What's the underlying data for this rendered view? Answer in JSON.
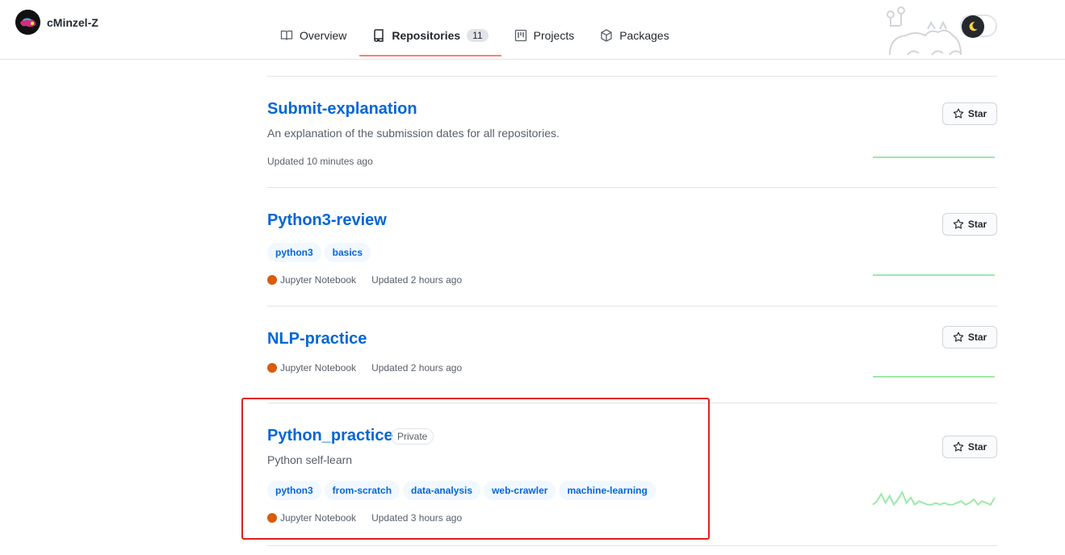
{
  "user": {
    "name": "cMinzel-Z"
  },
  "tabs": [
    {
      "label": "Overview",
      "icon": "book-icon"
    },
    {
      "label": "Repositories",
      "icon": "repo-icon",
      "count": "11"
    },
    {
      "label": "Projects",
      "icon": "project-icon"
    },
    {
      "label": "Packages",
      "icon": "package-icon"
    }
  ],
  "theme_toggle": {
    "icon": "moon-icon",
    "accent": "#ffd33d"
  },
  "colors": {
    "link": "#0366d6",
    "jupyter": "#DA5B0B",
    "spark": "#9be9a8",
    "highlight": "#e0201c",
    "tab_underline": "#f9826c"
  },
  "repos": [
    {
      "name": "Submit-explanation",
      "description": "An explanation of the submission dates for all repositories.",
      "topics": [],
      "language": "",
      "updated": "Updated 10 minutes ago",
      "star_label": "Star",
      "activity": [
        0,
        0,
        0,
        0,
        0,
        0,
        0,
        0,
        0,
        0,
        0,
        0,
        0,
        0,
        0,
        0,
        0,
        0,
        0,
        0
      ]
    },
    {
      "name": "Python3-review",
      "description": "",
      "topics": [
        "python3",
        "basics"
      ],
      "language": "Jupyter Notebook",
      "updated": "Updated 2 hours ago",
      "star_label": "Star",
      "activity": [
        0,
        0,
        0,
        0,
        0,
        0,
        0,
        0,
        0,
        0,
        0,
        0,
        0,
        0,
        0,
        0,
        0,
        0,
        0,
        0
      ]
    },
    {
      "name": "NLP-practice",
      "description": "",
      "topics": [],
      "language": "Jupyter Notebook",
      "updated": "Updated 2 hours ago",
      "star_label": "Star",
      "activity": [
        0,
        0,
        0,
        0,
        0,
        0,
        0,
        0,
        0,
        0,
        0,
        0,
        0,
        0,
        0,
        0,
        0,
        0,
        0,
        0
      ]
    },
    {
      "name": "Python_practice",
      "private_label": "Private",
      "description": "Python self-learn",
      "topics": [
        "python3",
        "from-scratch",
        "data-analysis",
        "web-crawler",
        "machine-learning"
      ],
      "language": "Jupyter Notebook",
      "updated": "Updated 3 hours ago",
      "star_label": "Star",
      "activity": [
        2,
        4,
        8,
        3,
        7,
        2,
        5,
        9,
        3,
        6,
        2,
        4,
        3,
        2,
        2,
        3,
        2,
        3,
        2,
        2,
        3,
        4,
        2,
        3,
        5,
        2,
        4,
        3,
        2,
        6
      ]
    }
  ]
}
